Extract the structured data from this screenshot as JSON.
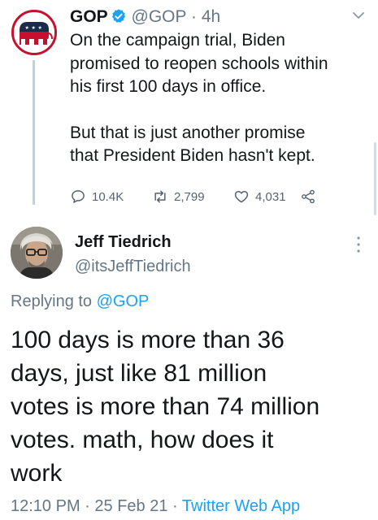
{
  "parent_tweet": {
    "display_name": "GOP",
    "handle": "@GOP",
    "separator": "·",
    "time": "4h",
    "text_lines": [
      "On the campaign trial, Biden",
      "promised to reopen schools within",
      "his first 100 days in office.",
      "",
      "But that is just another promise",
      "that President Biden hasn't kept."
    ],
    "replies_count": "10.4K",
    "retweets_count": "2,799",
    "likes_count": "4,031"
  },
  "reply_tweet": {
    "display_name": "Jeff Tiedrich",
    "handle": "@itsJeffTiedrich",
    "replying_prefix": "Replying to",
    "replying_to": "@GOP",
    "text_lines": [
      "100 days is more than 36",
      "days, just like 81 million",
      "votes is more than 74 million",
      "votes. math, how does it",
      "work"
    ],
    "time": "12:10 PM",
    "date": "25 Feb 21",
    "separator": "·",
    "client": "Twitter Web App"
  },
  "colors": {
    "link": "#1da1f2",
    "secondary_text": "#657786",
    "gop_red": "#c8102e",
    "gop_navy": "#1b2a4a"
  },
  "icons": [
    "gop-elephant-logo",
    "verified-badge-icon",
    "chevron-down-icon",
    "reply-icon",
    "retweet-icon",
    "like-icon",
    "share-icon",
    "more-vertical-icon"
  ]
}
